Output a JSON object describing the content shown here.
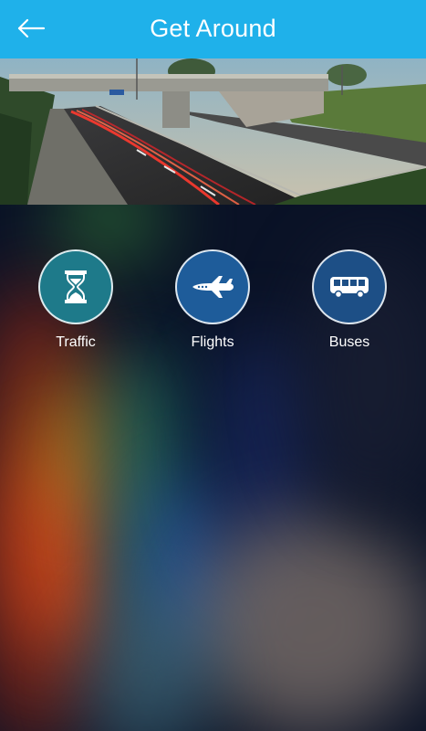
{
  "header": {
    "title": "Get Around",
    "back_icon": "arrow-left-icon",
    "background_color": "#1fb1ea"
  },
  "hero": {
    "image": "highway-light-trails-overpass-photo"
  },
  "tiles": [
    {
      "label": "Traffic",
      "icon": "hourglass-icon",
      "color": "#1e7a8a"
    },
    {
      "label": "Flights",
      "icon": "airplane-icon",
      "color": "#1e5c9a"
    },
    {
      "label": "Buses",
      "icon": "bus-icon",
      "color": "#1d4f86"
    }
  ]
}
